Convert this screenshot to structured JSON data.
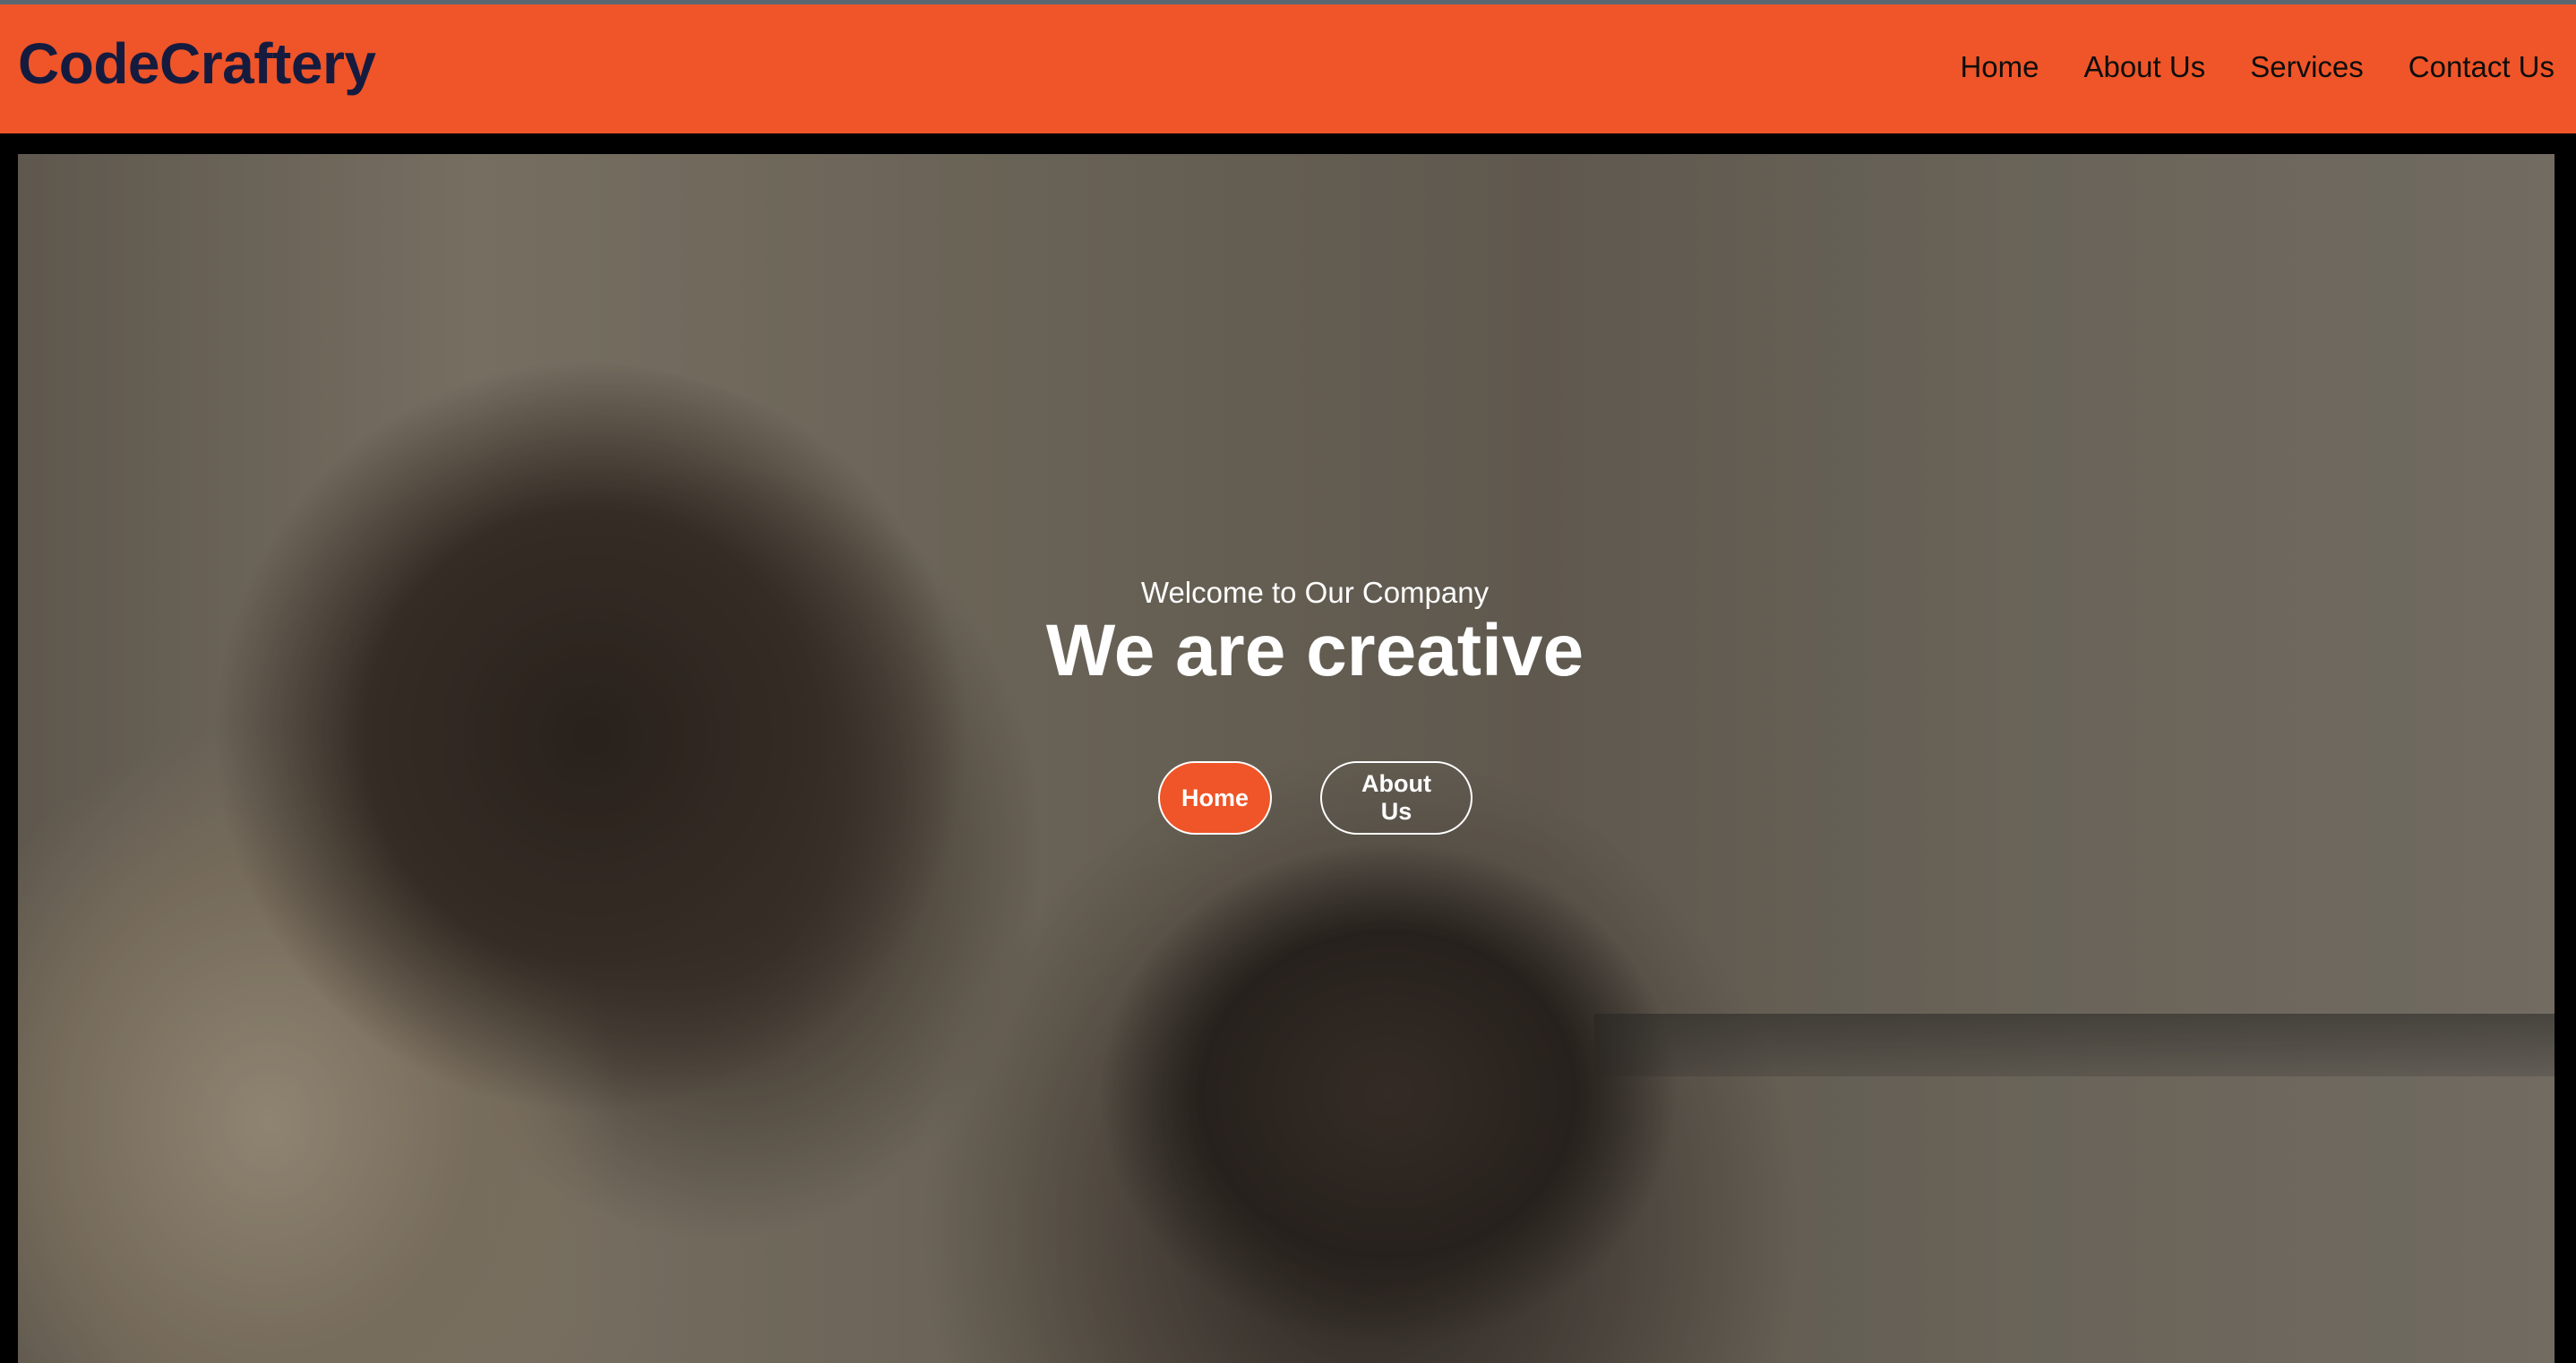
{
  "brand": {
    "logo_text": "CodeCraftery"
  },
  "nav": {
    "items": [
      {
        "label": "Home"
      },
      {
        "label": "About Us"
      },
      {
        "label": "Services"
      },
      {
        "label": "Contact Us"
      }
    ]
  },
  "hero": {
    "subtitle": "Welcome to Our Company",
    "title": "We are creative",
    "buttons": {
      "primary_label": "Home",
      "secondary_label": "About Us"
    }
  },
  "colors": {
    "accent": "#ef5528",
    "logo": "#151b3f",
    "nav_text": "#0d0d0d",
    "hero_text": "#ffffff"
  }
}
